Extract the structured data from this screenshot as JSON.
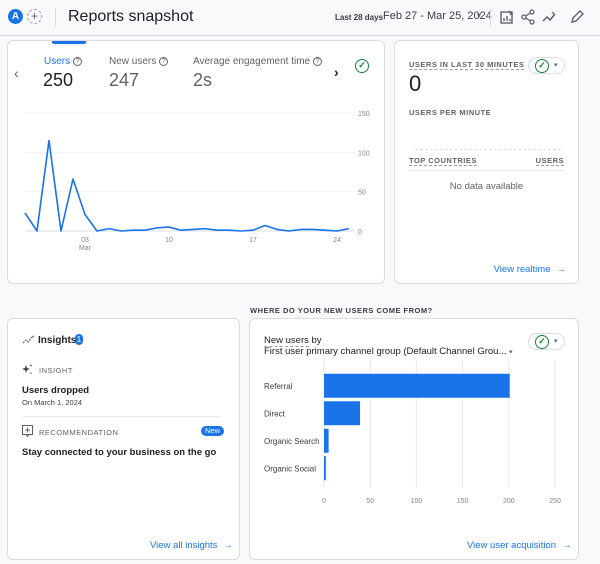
{
  "header": {
    "avatar_letter": "A",
    "add_label": "+",
    "title": "Reports snapshot",
    "date_chip": "Last 28 days",
    "date_range": "Feb 27 - Mar 25, 2024",
    "date_caret": "▾",
    "icons": [
      "customize-report-icon",
      "share-icon",
      "insights-icon",
      "edit-icon"
    ]
  },
  "overview": {
    "prev_arrow": "‹",
    "next_arrow": "›",
    "check": "✓",
    "help": "?",
    "metrics": [
      {
        "label": "Users",
        "value": "250",
        "active": true
      },
      {
        "label": "New users",
        "value": "247",
        "active": false
      },
      {
        "label": "Average engagement time",
        "value": "2s",
        "active": false
      }
    ]
  },
  "realtime": {
    "title": "Users in last 30 minutes",
    "value": "0",
    "per_minute": "Users per minute",
    "col_countries": "Top countries",
    "col_users": "Users",
    "empty": "No data available",
    "link": "View realtime",
    "check": "✓",
    "caret": "▾"
  },
  "insights": {
    "title": "Insights",
    "count": "1",
    "insight_caption": "Insight",
    "insight_title": "Users dropped",
    "insight_date": "On March 1, 2024",
    "rec_caption": "Recommendation",
    "rec_badge": "New",
    "rec_title": "Stay connected to your business on the go",
    "link": "View all insights"
  },
  "acquisition": {
    "section_title": "WHERE DO YOUR NEW USERS COME FROM?",
    "metric_label": "New users",
    "by_label": "by",
    "dimension": "First user primary channel group (Default Channel Grou...",
    "dim_caret": "▾",
    "check": "✓",
    "caret": "▾",
    "link": "View user acquisition"
  },
  "arrow": "→",
  "chart_data": [
    {
      "type": "line",
      "title": "Users",
      "x": [
        "Feb 27",
        "Feb 28",
        "Feb 29",
        "Mar 1",
        "Mar 2",
        "Mar 3",
        "Mar 4",
        "Mar 5",
        "Mar 6",
        "Mar 7",
        "Mar 8",
        "Mar 9",
        "Mar 10",
        "Mar 11",
        "Mar 12",
        "Mar 13",
        "Mar 14",
        "Mar 15",
        "Mar 16",
        "Mar 17",
        "Mar 18",
        "Mar 19",
        "Mar 20",
        "Mar 21",
        "Mar 22",
        "Mar 23",
        "Mar 24",
        "Mar 25"
      ],
      "series": [
        {
          "name": "Users",
          "values": [
            23,
            0,
            115,
            0,
            66,
            21,
            0,
            3,
            0,
            1,
            1,
            4,
            5,
            1,
            2,
            3,
            1,
            1,
            0,
            1,
            7,
            2,
            0,
            2,
            2,
            1,
            0,
            3
          ],
          "color": "#1a73e8"
        }
      ],
      "x_ticks": [
        {
          "index": 5,
          "label": "03",
          "sublabel": "Mar"
        },
        {
          "index": 12,
          "label": "10"
        },
        {
          "index": 19,
          "label": "17"
        },
        {
          "index": 26,
          "label": "24"
        }
      ],
      "y_ticks": [
        0,
        50,
        100,
        150
      ],
      "ylim": [
        0,
        150
      ],
      "y_axis_side": "right",
      "grid": true
    },
    {
      "type": "bar",
      "orientation": "horizontal",
      "title": "New users by First user primary channel group (Default Channel Group)",
      "categories": [
        "Referral",
        "Direct",
        "Organic Search",
        "Organic Social"
      ],
      "values": [
        201,
        39,
        5,
        2
      ],
      "color": "#1a73e8",
      "x_ticks": [
        0,
        50,
        100,
        150,
        200,
        250
      ],
      "xlim": [
        0,
        250
      ],
      "grid": true
    }
  ]
}
